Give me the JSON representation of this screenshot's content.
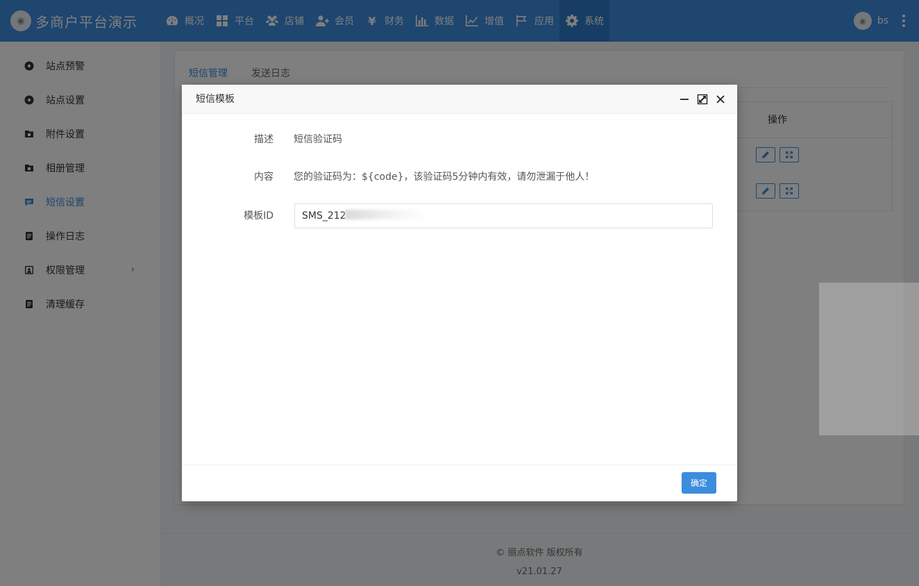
{
  "header": {
    "brand_name": "多商户平台演示",
    "nav": [
      {
        "label": "概况",
        "icon": "dashboard-icon"
      },
      {
        "label": "平台",
        "icon": "grid-icon"
      },
      {
        "label": "店铺",
        "icon": "users-icon"
      },
      {
        "label": "会员",
        "icon": "user-plus-icon"
      },
      {
        "label": "财务",
        "icon": "yen-icon"
      },
      {
        "label": "数据",
        "icon": "bar-chart-icon"
      },
      {
        "label": "增值",
        "icon": "line-chart-icon"
      },
      {
        "label": "应用",
        "icon": "flag-icon"
      },
      {
        "label": "系统",
        "icon": "gear-icon"
      }
    ],
    "active_nav": "系统",
    "user_name": "bs"
  },
  "sidebar": {
    "items": [
      {
        "label": "站点预警",
        "icon": "disc-icon"
      },
      {
        "label": "站点设置",
        "icon": "disc-icon"
      },
      {
        "label": "附件设置",
        "icon": "folder-icon"
      },
      {
        "label": "相册管理",
        "icon": "folder-icon"
      },
      {
        "label": "短信设置",
        "icon": "message-icon"
      },
      {
        "label": "操作日志",
        "icon": "document-icon"
      },
      {
        "label": "权限管理",
        "icon": "id-card-icon",
        "arrow": "›"
      },
      {
        "label": "清理缓存",
        "icon": "document-icon"
      }
    ],
    "active": "短信设置"
  },
  "main": {
    "tabs": [
      "短信管理",
      "发送日志"
    ],
    "active_tab": "短信管理",
    "table": {
      "columns": [
        "操作"
      ],
      "rows": [
        {
          "actions": [
            "edit-icon",
            "expand-icon"
          ]
        },
        {
          "actions": [
            "edit-icon",
            "expand-icon"
          ]
        }
      ]
    }
  },
  "footer": {
    "copyright": "© 丽点软件 版权所有",
    "version": "v21.01.27"
  },
  "modal": {
    "title": "短信模板",
    "fields": [
      {
        "label": "描述",
        "value": "短信验证码"
      },
      {
        "label": "内容",
        "value": "您的验证码为：${code}，该验证码5分钟内有效，请勿泄漏于他人！"
      },
      {
        "label": "模板ID",
        "value": "SMS_212"
      }
    ],
    "ok_label": "确定"
  },
  "colors": {
    "primary": "#3c8dde",
    "topbar": "#3c8dde",
    "overlay": "rgba(0,0,0,0.5)"
  }
}
